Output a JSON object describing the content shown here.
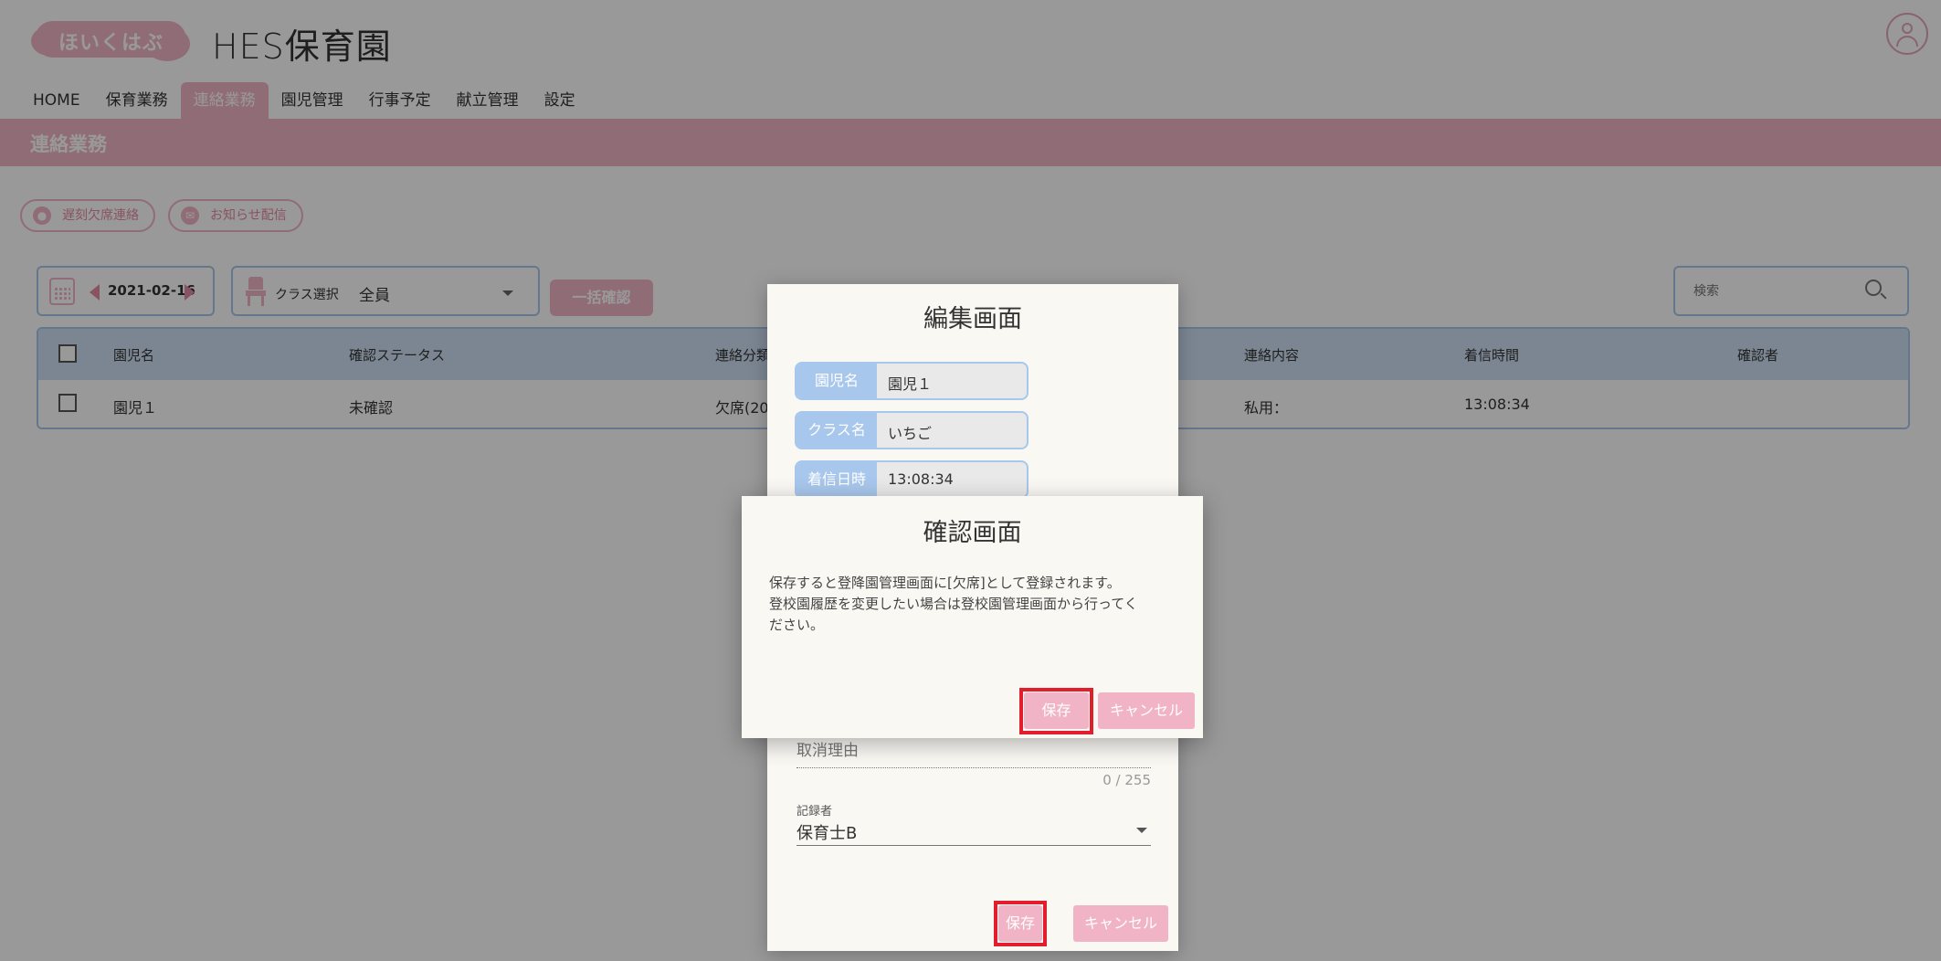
{
  "header": {
    "logo_text": "ほいくはぶ",
    "site_title": "HES保育園"
  },
  "nav": {
    "items": [
      {
        "label": "HOME"
      },
      {
        "label": "保育業務"
      },
      {
        "label": "連絡業務"
      },
      {
        "label": "園児管理"
      },
      {
        "label": "行事予定"
      },
      {
        "label": "献立管理"
      },
      {
        "label": "設定"
      }
    ],
    "active": "連絡業務"
  },
  "section": {
    "title": "連絡業務"
  },
  "subtoolbar": {
    "absence_button": "遅刻欠席連絡",
    "notice_button": "お知らせ配信"
  },
  "filters": {
    "date": "2021-02-16",
    "class_label": "クラス選択",
    "class_value": "全員",
    "bulk_confirm": "一括確認",
    "search_placeholder": "検索"
  },
  "table": {
    "headers": [
      "園児名",
      "確認ステータス",
      "連絡分類",
      "連絡内容",
      "着信時間",
      "確認者"
    ],
    "rows": [
      {
        "name": "園児１",
        "status": "未確認",
        "category": "欠席(20",
        "content": "私用：",
        "time": "13:08:34",
        "confirmer": ""
      }
    ]
  },
  "edit_dialog": {
    "title": "編集画面",
    "fields": [
      {
        "label": "園児名",
        "value": "園児１"
      },
      {
        "label": "クラス名",
        "value": "いちご"
      },
      {
        "label": "着信日時",
        "value": "13:08:34"
      }
    ],
    "cancel_reason_placeholder": "取消理由",
    "counter": "0 / 255",
    "recorder_label": "記録者",
    "recorder_value": "保育士B",
    "save": "保存",
    "cancel": "キャンセル"
  },
  "confirm_dialog": {
    "title": "確認画面",
    "message_line1": "保存すると登降園管理画面に[欠席]として登録されます。",
    "message_line2": "登校園履歴を変更したい場合は登校園管理画面から行ってく",
    "message_line3": "ださい。",
    "save": "保存",
    "cancel": "キャンセル"
  },
  "colors": {
    "accent_pink": "#f1b4c6",
    "accent_blue": "#a8c7ec",
    "highlight_red": "#e21d2c"
  }
}
